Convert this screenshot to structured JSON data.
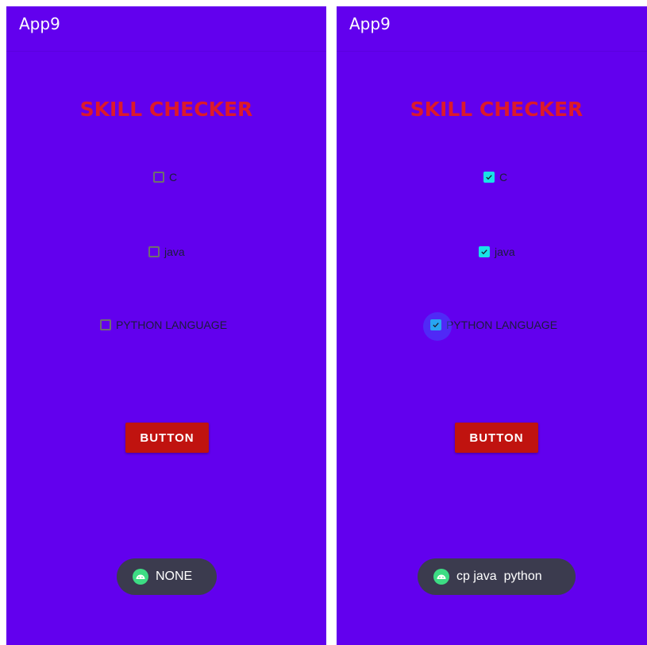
{
  "screens": [
    {
      "app_title": "App9",
      "heading": "SKILL CHECKER",
      "checkboxes": [
        {
          "label": "C",
          "checked": false
        },
        {
          "label": "java",
          "checked": false
        },
        {
          "label": "PYTHON LANGUAGE",
          "checked": false
        }
      ],
      "button_label": "BUTTON",
      "toast": {
        "icon": "android-icon",
        "text": "NONE"
      }
    },
    {
      "app_title": "App9",
      "heading": "SKILL CHECKER",
      "checkboxes": [
        {
          "label": "C",
          "checked": true
        },
        {
          "label": "java",
          "checked": true
        },
        {
          "label": "PYTHON LANGUAGE",
          "checked": true
        }
      ],
      "button_label": "BUTTON",
      "toast": {
        "icon": "android-icon",
        "text": "cp java  python"
      }
    }
  ],
  "colors": {
    "app_background": "#6200ee",
    "heading": "#dc1a2b",
    "checkbox_checked": "#18e2e6",
    "button": "#c0130f",
    "toast": "#3b3b4e"
  }
}
